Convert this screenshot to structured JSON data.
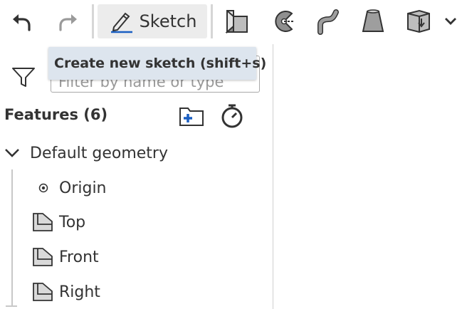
{
  "toolbar": {
    "undo_icon": "undo-arrow-icon",
    "redo_icon": "redo-arrow-icon",
    "sketch_label": "Sketch",
    "tools": [
      "extrude-icon",
      "revolve-icon",
      "sweep-icon",
      "loft-icon",
      "derived-part-icon",
      "chevron-down-icon"
    ]
  },
  "tooltip": {
    "text": "Create new sketch (shift+s)"
  },
  "filter": {
    "placeholder": "Filter by name or type",
    "value": ""
  },
  "features": {
    "title": "Features (6)",
    "add_folder_icon": "add-folder-icon",
    "rollback_icon": "stopwatch-icon",
    "tree": {
      "group_label": "Default geometry",
      "items": [
        {
          "label": "Origin",
          "icon": "origin-point-icon"
        },
        {
          "label": "Top",
          "icon": "plane-icon"
        },
        {
          "label": "Front",
          "icon": "plane-icon"
        },
        {
          "label": "Right",
          "icon": "plane-icon"
        }
      ]
    }
  },
  "colors": {
    "accent_blue": "#1a5fc2",
    "icon_gray": "#333333",
    "tooltip_bg": "#dde5ee",
    "disabled": "#9a9a9a"
  }
}
